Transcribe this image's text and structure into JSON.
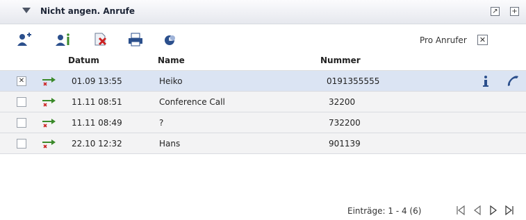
{
  "header": {
    "title": "Nicht angen. Anrufe"
  },
  "toolbar": {
    "pro_anrufer_label": "Pro Anrufer",
    "pro_anrufer_checked": "☒"
  },
  "table": {
    "columns": {
      "datum": "Datum",
      "name": "Name",
      "nummer": "Nummer"
    },
    "rows": [
      {
        "checked": "✕",
        "datum": "01.09 13:55",
        "name": "Heiko",
        "nummer": "0191355555"
      },
      {
        "checked": "",
        "datum": "11.11 08:51",
        "name": "Conference Call",
        "nummer": "32200"
      },
      {
        "checked": "",
        "datum": "11.11 08:49",
        "name": "?",
        "nummer": "732200"
      },
      {
        "checked": "",
        "datum": "22.10 12:32",
        "name": "Hans",
        "nummer": "901139"
      }
    ]
  },
  "footer": {
    "entries": "Einträge: 1 - 4 (6)"
  },
  "colors": {
    "accent": "#2b4f8c",
    "selected_row": "#dbe4f3",
    "missed_red": "#cc2222",
    "arrow_green": "#3a8a2a"
  }
}
